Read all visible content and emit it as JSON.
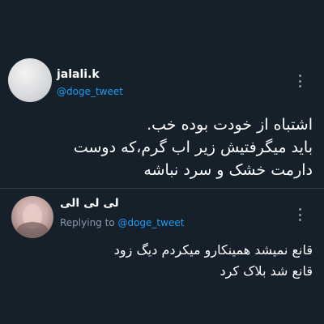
{
  "main_tweet": {
    "display_name": "jalali.k",
    "handle": "@doge_tweet",
    "lines": [
      "اشتباه از خودت بوده خب.",
      "باید میگرفتیش زیر اب گرم،که دوست",
      "دارمت خشک و سرد نباشه"
    ],
    "avatar_icon": "default-avatar",
    "more_icon": "vertical-ellipsis"
  },
  "reply_tweet": {
    "display_name": "لی لی الی",
    "replying_prefix": "Replying to ",
    "replying_handle": "@doge_tweet",
    "lines": [
      "قانع نمیشد همینکارو میکردم دیگ زود",
      "قانع شد بلاک کرد"
    ],
    "avatar_icon": "user-avatar",
    "more_icon": "vertical-ellipsis"
  },
  "colors": {
    "background": "#15202b",
    "text": "#ffffff",
    "accent": "#1d9bf0",
    "muted": "#8b98a5",
    "divider": "#2f3b47"
  }
}
